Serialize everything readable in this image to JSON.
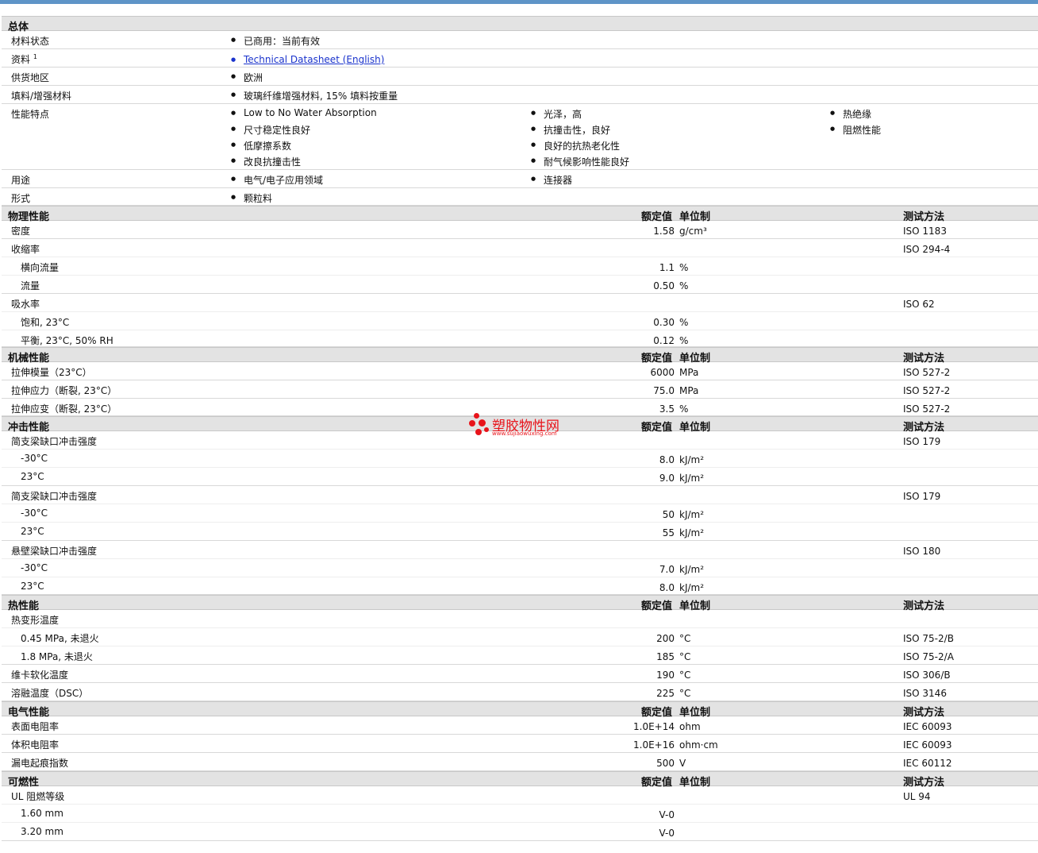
{
  "general": {
    "title": "总体",
    "rows": [
      {
        "label": "材料状态",
        "items": [
          "已商用：当前有效"
        ]
      },
      {
        "label": "资料",
        "sup": "1",
        "items": [
          "Technical Datasheet (English)"
        ]
      },
      {
        "label": "供货地区",
        "items": [
          "欧洲"
        ]
      },
      {
        "label": "填料/增强材料",
        "items": [
          "玻璃纤维增强材料, 15% 填料按重量"
        ]
      },
      {
        "label": "性能特点",
        "items": [
          "Low to No Water Absorption",
          "尺寸稳定性良好",
          "低摩擦系数",
          "改良抗撞击性",
          "光泽，高",
          "抗撞击性，良好",
          "良好的抗热老化性",
          "耐气候影响性能良好",
          "热绝缘",
          "阻燃性能"
        ]
      },
      {
        "label": "用途",
        "items": [
          "电气/电子应用领域",
          "连接器"
        ]
      },
      {
        "label": "形式",
        "items": [
          "颗粒料"
        ]
      }
    ]
  },
  "headers": {
    "nominal": "额定值",
    "unit": "单位制",
    "method": "测试方法"
  },
  "physical": {
    "title": "物理性能",
    "rows": [
      {
        "label": "密度",
        "value": "1.58",
        "unit": "g/cm³",
        "method": "ISO 1183"
      },
      {
        "label": "收缩率",
        "method": "ISO 294-4"
      },
      {
        "label": "横向流量",
        "value": "1.1",
        "unit": "%"
      },
      {
        "label": "流量",
        "value": "0.50",
        "unit": "%"
      },
      {
        "label": "吸水率",
        "method": "ISO 62"
      },
      {
        "label": "饱和, 23°C",
        "value": "0.30",
        "unit": "%"
      },
      {
        "label": "平衡, 23°C, 50% RH",
        "value": "0.12",
        "unit": "%"
      }
    ]
  },
  "mechanical": {
    "title": "机械性能",
    "rows": [
      {
        "label": "拉伸模量（23°C）",
        "value": "6000",
        "unit": "MPa",
        "method": "ISO 527-2"
      },
      {
        "label": "拉伸应力（断裂, 23°C）",
        "value": "75.0",
        "unit": "MPa",
        "method": "ISO 527-2"
      },
      {
        "label": "拉伸应变（断裂, 23°C）",
        "value": "3.5",
        "unit": "%",
        "method": "ISO 527-2"
      }
    ]
  },
  "impact": {
    "title": "冲击性能",
    "rows": [
      {
        "label": "简支梁缺口冲击强度",
        "method": "ISO 179"
      },
      {
        "label": "-30°C",
        "value": "8.0",
        "unit": "kJ/m²"
      },
      {
        "label": "23°C",
        "value": "9.0",
        "unit": "kJ/m²"
      },
      {
        "label": "简支梁缺口冲击强度",
        "method": "ISO 179"
      },
      {
        "label": "-30°C",
        "value": "50",
        "unit": "kJ/m²"
      },
      {
        "label": "23°C",
        "value": "55",
        "unit": "kJ/m²"
      },
      {
        "label": "悬壁梁缺口冲击强度",
        "method": "ISO 180"
      },
      {
        "label": "-30°C",
        "value": "7.0",
        "unit": "kJ/m²"
      },
      {
        "label": "23°C",
        "value": "8.0",
        "unit": "kJ/m²"
      }
    ]
  },
  "thermal": {
    "title": "热性能",
    "rows": [
      {
        "label": "热变形温度"
      },
      {
        "label": "0.45 MPa, 未退火",
        "value": "200",
        "unit": "°C",
        "method": "ISO 75-2/B"
      },
      {
        "label": "1.8 MPa, 未退火",
        "value": "185",
        "unit": "°C",
        "method": "ISO 75-2/A"
      },
      {
        "label": "维卡软化温度",
        "value": "190",
        "unit": "°C",
        "method": "ISO 306/B"
      },
      {
        "label": "溶融温度（DSC）",
        "value": "225",
        "unit": "°C",
        "method": "ISO 3146"
      }
    ]
  },
  "electrical": {
    "title": "电气性能",
    "rows": [
      {
        "label": "表面电阻率",
        "value": "1.0E+14",
        "unit": "ohm",
        "method": "IEC 60093"
      },
      {
        "label": "体积电阻率",
        "value": "1.0E+16",
        "unit": "ohm·cm",
        "method": "IEC 60093"
      },
      {
        "label": "漏电起痕指数",
        "value": "500",
        "unit": "V",
        "method": "IEC 60112"
      }
    ]
  },
  "flammability": {
    "title": "可燃性",
    "rows": [
      {
        "label": "UL 阻燃等级",
        "method": "UL 94"
      },
      {
        "label": "1.60 mm",
        "value": "V-0"
      },
      {
        "label": "3.20 mm",
        "value": "V-0"
      }
    ]
  },
  "watermark": {
    "name": "塑胶物性网",
    "url": "www.sujiaowuxing.com",
    "color": "#e8131a"
  },
  "colors": {
    "accent_bar": "#5e94c7",
    "section_bg": "#e3e3e3",
    "link": "#1a33cc"
  }
}
